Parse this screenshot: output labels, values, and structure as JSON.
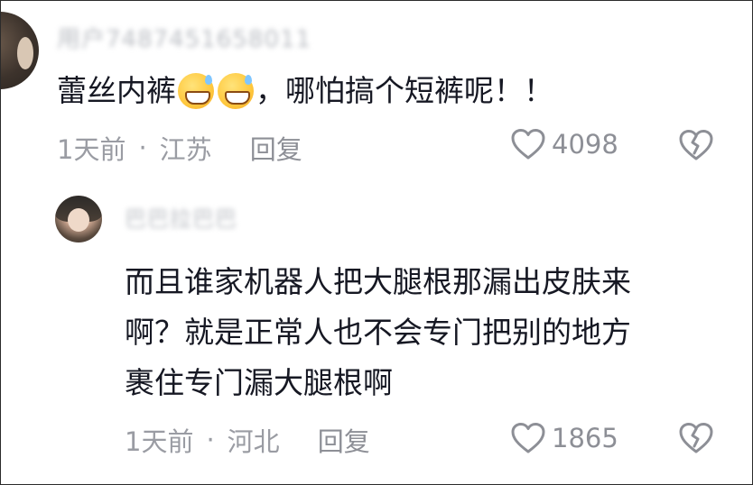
{
  "comment": {
    "username": "用户7487451658011",
    "text_before_emoji": "蕾丝内裤",
    "emoji_icons": [
      "grinning-sweat-emoji",
      "grinning-sweat-emoji"
    ],
    "text_after_emoji": "，哪怕搞个短裤呢！！",
    "time": "1天前",
    "separator": "·",
    "location": "江苏",
    "reply_label": "回复",
    "likes": "4098"
  },
  "reply": {
    "username": "巴巴拉巴巴",
    "lines": [
      "而且谁家机器人把大腿根那漏出皮肤来",
      "啊？就是正常人也不会专门把别的地方",
      "裹住专门漏大腿根啊"
    ],
    "time": "1天前",
    "separator": "·",
    "location": "河北",
    "reply_label": "回复",
    "likes": "1865"
  },
  "colors": {
    "text": "#161823",
    "meta": "#9a9ca3",
    "icon": "#8d8f96",
    "border": "#2b2b2b"
  }
}
